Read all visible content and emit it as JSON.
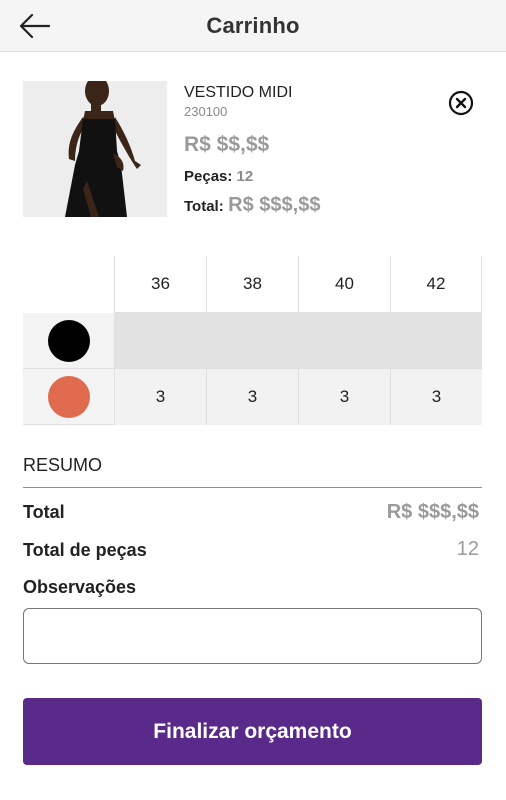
{
  "header": {
    "title": "Carrinho",
    "back_icon": "arrow-left-icon"
  },
  "product": {
    "name": "VESTIDO MIDI",
    "code": "230100",
    "price": "R$ $$,$$",
    "pieces_label": "Peças:",
    "pieces_value": "12",
    "total_label": "Total:",
    "total_value": "R$ $$$,$$",
    "remove_icon": "close-circle-icon"
  },
  "grid": {
    "sizes": [
      "36",
      "38",
      "40",
      "42"
    ],
    "colors": [
      {
        "name": "black",
        "hex": "#000000",
        "quantities": [
          "",
          "",
          "",
          ""
        ],
        "unavailable": true
      },
      {
        "name": "terracotta",
        "hex": "#e06a4e",
        "quantities": [
          "3",
          "3",
          "3",
          "3"
        ],
        "unavailable": false
      }
    ]
  },
  "summary": {
    "title": "RESUMO",
    "total_label": "Total",
    "total_value": "R$ $$$,$$",
    "pieces_label": "Total de peças",
    "pieces_value": "12",
    "notes_label": "Observações",
    "notes_value": "",
    "notes_placeholder": ""
  },
  "cta": {
    "label": "Finalizar orçamento"
  },
  "colors": {
    "accent": "#5a2a8a",
    "header_bg": "#f5f5f5",
    "muted_text": "#9a9a9a"
  }
}
